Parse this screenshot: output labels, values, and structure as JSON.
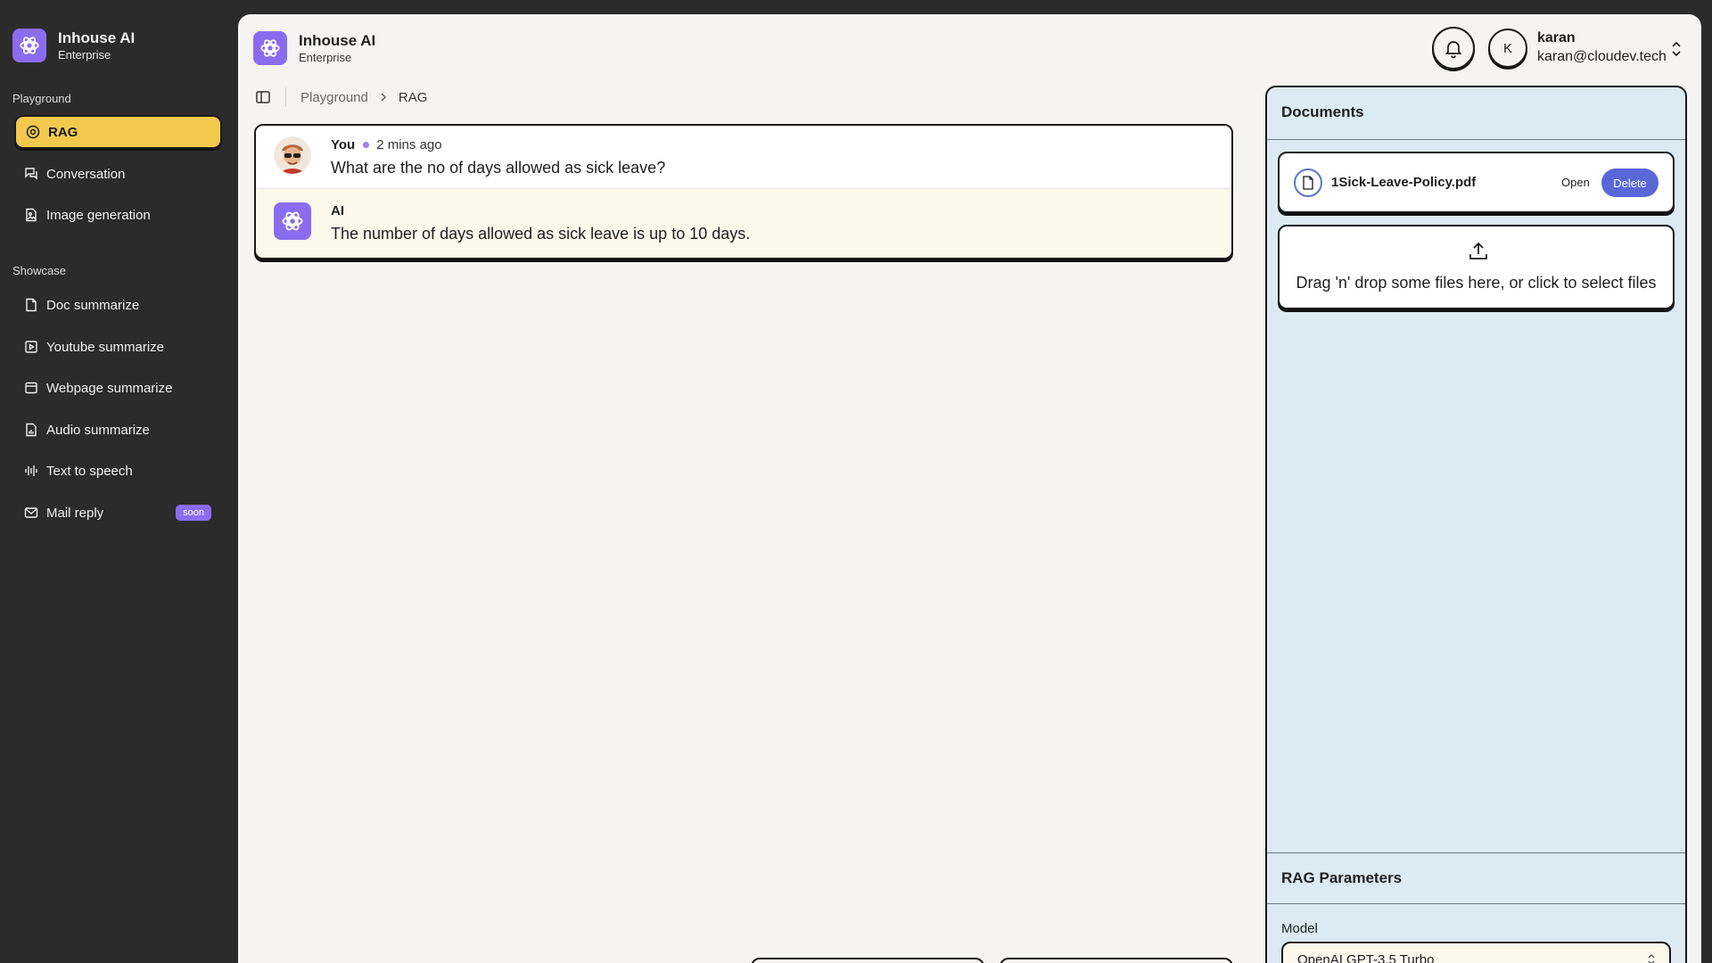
{
  "app": {
    "title": "Inhouse AI",
    "subtitle": "Enterprise",
    "accent_color": "#8b6cf0",
    "active_color": "#f2c94c"
  },
  "sidebar": {
    "playground_label": "Playground",
    "playground_items": [
      {
        "label": "RAG",
        "icon": "rag-icon",
        "active": true
      },
      {
        "label": "Conversation",
        "icon": "conversation-icon"
      },
      {
        "label": "Image generation",
        "icon": "image-file-icon"
      }
    ],
    "showcase_label": "Showcase",
    "showcase_items": [
      {
        "label": "Doc summarize",
        "icon": "document-icon"
      },
      {
        "label": "Youtube summarize",
        "icon": "play-square-icon"
      },
      {
        "label": "Webpage summarize",
        "icon": "browser-icon"
      },
      {
        "label": "Audio summarize",
        "icon": "audio-file-icon"
      },
      {
        "label": "Text to speech",
        "icon": "audio-waves-icon"
      },
      {
        "label": "Mail reply",
        "icon": "mail-icon",
        "badge": "soon"
      }
    ]
  },
  "header": {
    "title": "Inhouse AI",
    "subtitle": "Enterprise",
    "user": {
      "initial": "K",
      "name": "karan",
      "email": "karan@cloudev.tech"
    }
  },
  "breadcrumb": {
    "parent": "Playground",
    "current": "RAG"
  },
  "chat": {
    "messages": [
      {
        "author": "You",
        "time": "2 mins ago",
        "text": "What are the no of days allowed as sick leave?"
      },
      {
        "author": "AI",
        "text": "The number of days allowed as sick leave is up to 10 days."
      }
    ]
  },
  "documents": {
    "title": "Documents",
    "files": [
      {
        "name": "1Sick-Leave-Policy.pdf",
        "open_label": "Open",
        "delete_label": "Delete"
      }
    ],
    "dropzone_text": "Drag 'n' drop some files here, or click to select files"
  },
  "rag_parameters": {
    "title": "RAG Parameters",
    "model_label": "Model",
    "model_value": "OpenAI GPT-3.5 Turbo"
  }
}
